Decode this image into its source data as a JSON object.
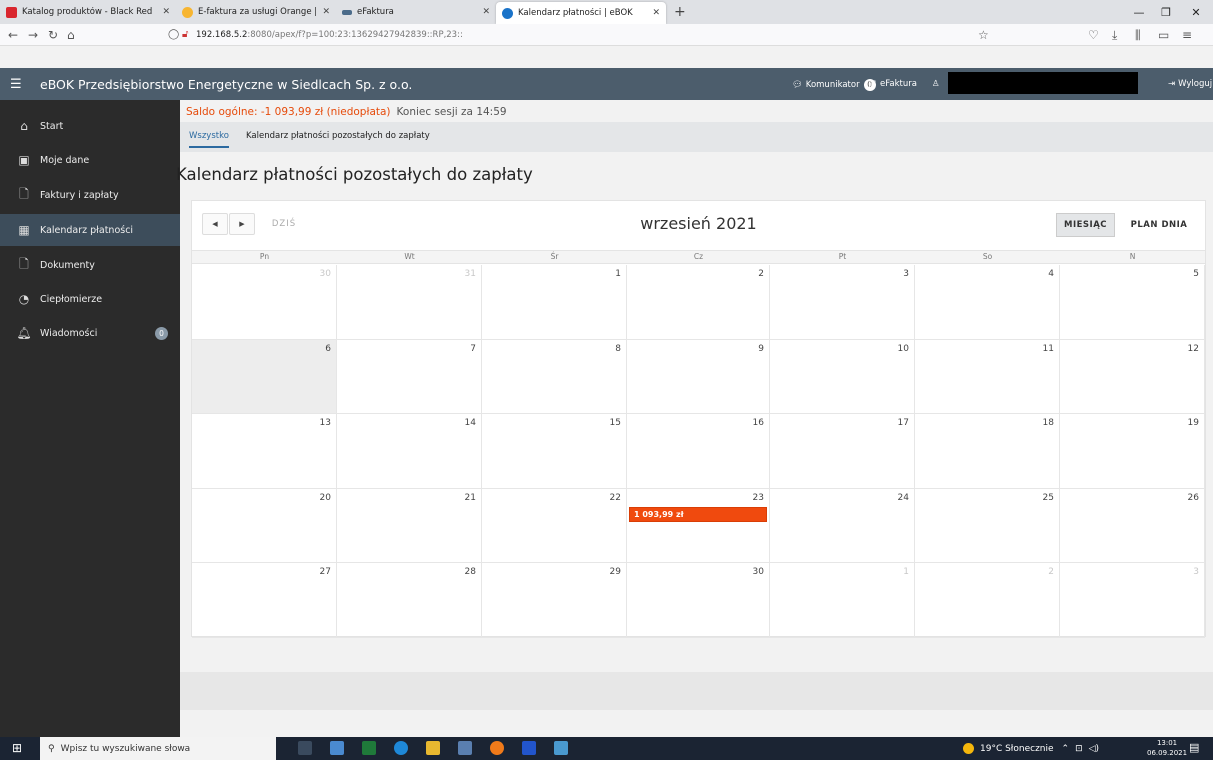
{
  "browser": {
    "tabs": [
      {
        "title": "Katalog produktów - Black Red",
        "color": "#d9262e"
      },
      {
        "title": "E-faktura za usługi Orange | Ora",
        "color": "#f7b531"
      },
      {
        "title": "eFaktura",
        "color": "#4b6b8a"
      },
      {
        "title": "Kalendarz płatności | eBOK",
        "color": "#1a73c9"
      }
    ],
    "url_main": "192.168.5.2",
    "url_rest": ":8080/apex/f?p=100:23:13629427942839::RP,23::"
  },
  "app": {
    "brand": "eBOK Przedsiębiorstwo Energetyczne w Siedlcach Sp. z o.o.",
    "komunikator_label": "Komunikator",
    "komunikator_count": "0",
    "efaktura_label": "eFaktura",
    "logout_label": "Wyloguj"
  },
  "sidebar": {
    "items": [
      {
        "label": "Start",
        "icon": "home-icon"
      },
      {
        "label": "Moje dane",
        "icon": "user-card-icon"
      },
      {
        "label": "Faktury i zapłaty",
        "icon": "invoice-icon"
      },
      {
        "label": "Kalendarz płatności",
        "icon": "calendar-icon"
      },
      {
        "label": "Dokumenty",
        "icon": "document-icon"
      },
      {
        "label": "Ciepłomierze",
        "icon": "gauge-icon"
      },
      {
        "label": "Wiadomości",
        "icon": "bell-icon",
        "badge": "0"
      }
    ]
  },
  "status": {
    "saldo": "Saldo ogólne: -1 093,99 zł (niedopłata)",
    "session": "Koniec sesji za 14:59"
  },
  "subnav": {
    "all": "Wszystko",
    "current": "Kalendarz płatności pozostałych do zapłaty"
  },
  "page": {
    "title": "Kalendarz płatności pozostałych do zapłaty"
  },
  "calendar": {
    "today_label": "DZIŚ",
    "month_label": "wrzesień 2021",
    "view_month": "MIESIĄC",
    "view_day": "PLAN DNIA",
    "days_of_week": [
      "Pn",
      "Wt",
      "Śr",
      "Cz",
      "Pt",
      "So",
      "N"
    ],
    "weeks": [
      [
        "30",
        "31",
        "1",
        "2",
        "3",
        "4",
        "5"
      ],
      [
        "6",
        "7",
        "8",
        "9",
        "10",
        "11",
        "12"
      ],
      [
        "13",
        "14",
        "15",
        "16",
        "17",
        "18",
        "19"
      ],
      [
        "20",
        "21",
        "22",
        "23",
        "24",
        "25",
        "26"
      ],
      [
        "27",
        "28",
        "29",
        "30",
        "1",
        "2",
        "3"
      ]
    ],
    "event": {
      "label": "1 093,99 zł",
      "day": "23",
      "color": "#f04a0e"
    }
  },
  "taskbar": {
    "search_placeholder": "Wpisz tu wyszukiwane słowa",
    "weather": "19°C Słonecznie",
    "time": "13:01",
    "date": "06.09.2021"
  }
}
